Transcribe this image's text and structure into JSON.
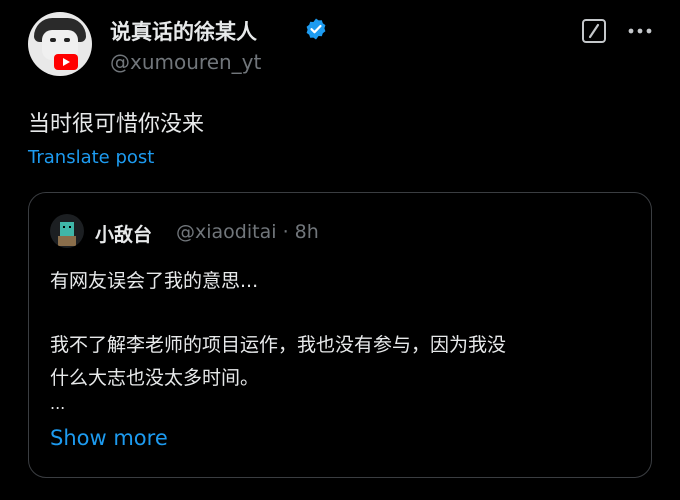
{
  "author": {
    "display_name": "说真话的徐某人",
    "handle": "@xumouren_yt",
    "avatar_icon": "meme-avatar-icon",
    "verified_icon": "verified-badge-icon"
  },
  "toolbar": {
    "grok_icon": "grok-icon",
    "more_icon": "more-options-icon"
  },
  "post": {
    "text": "当时很可惜你没来",
    "translate_label": "Translate post"
  },
  "quote": {
    "display_name": "小敌台",
    "handle": "@xiaoditai",
    "separator": "·",
    "time": "8h",
    "line1": "有网友误会了我的意思...",
    "line2": "我不了解李老师的项目运作，我也没有参与，因为我没",
    "line3": "什么大志也没太多时间。",
    "ellipsis": "...",
    "show_more_label": "Show more"
  },
  "colors": {
    "background": "#000000",
    "text": "#e7e9ea",
    "muted": "#71767b",
    "link": "#1d9bf0",
    "verified": "#1d9bf0",
    "border": "#3a3d41"
  }
}
